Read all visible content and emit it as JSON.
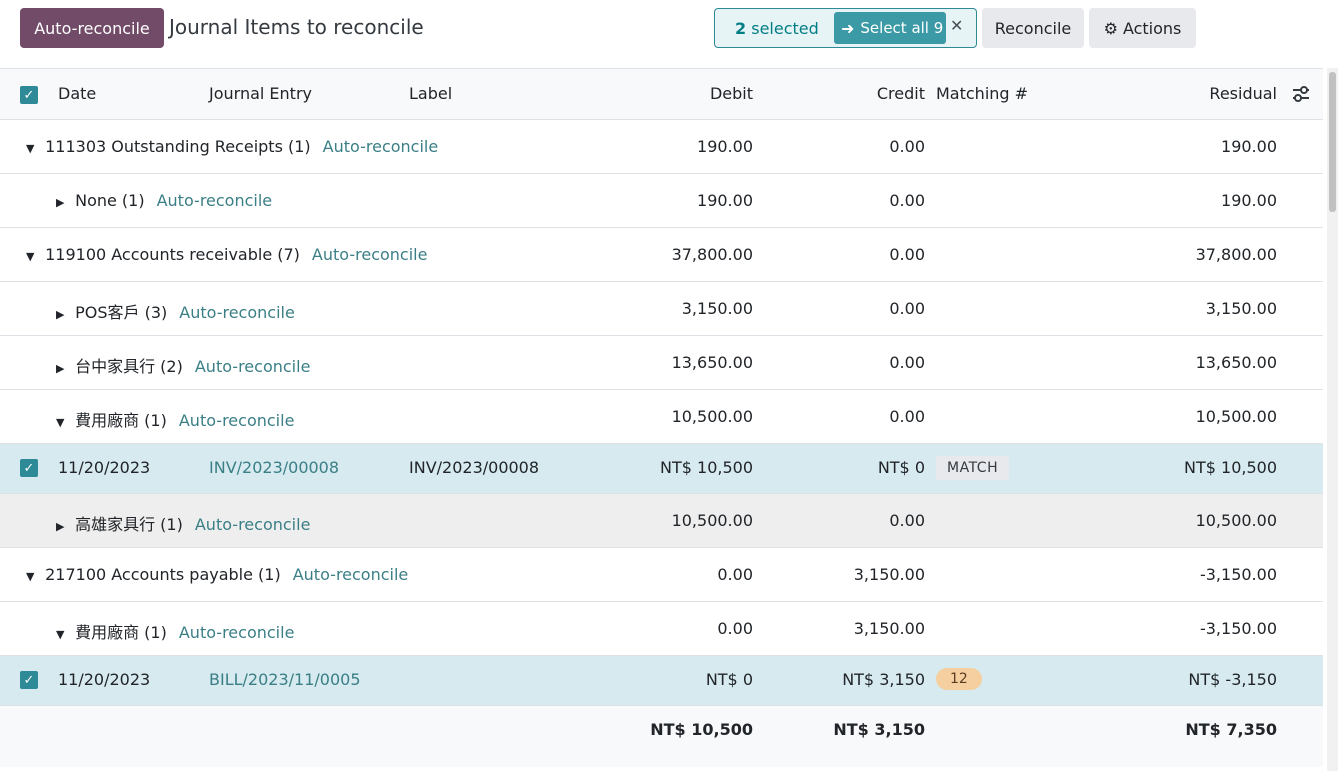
{
  "toolbar": {
    "auto_reconcile_label": "Auto-reconcile",
    "title": "Journal Items to reconcile",
    "selected_count": "2",
    "selected_text": "selected",
    "select_all_label": "Select all 9",
    "reconcile_label": "Reconcile",
    "actions_label": "Actions"
  },
  "columns": {
    "date": "Date",
    "journal_entry": "Journal Entry",
    "label": "Label",
    "debit": "Debit",
    "credit": "Credit",
    "matching": "Matching #",
    "residual": "Residual"
  },
  "rows": [
    {
      "name": "111303 Outstanding Receipts (1)",
      "link": "Auto-reconcile",
      "debit": "190.00",
      "credit": "0.00",
      "residual": "190.00"
    },
    {
      "name": "None (1)",
      "link": "Auto-reconcile",
      "debit": "190.00",
      "credit": "0.00",
      "residual": "190.00"
    },
    {
      "name": "119100 Accounts receivable (7)",
      "link": "Auto-reconcile",
      "debit": "37,800.00",
      "credit": "0.00",
      "residual": "37,800.00"
    },
    {
      "name": "POS客戶 (3)",
      "link": "Auto-reconcile",
      "debit": "3,150.00",
      "credit": "0.00",
      "residual": "3,150.00"
    },
    {
      "name": "台中家具行 (2)",
      "link": "Auto-reconcile",
      "debit": "13,650.00",
      "credit": "0.00",
      "residual": "13,650.00"
    },
    {
      "name": "費用廠商 (1)",
      "link": "Auto-reconcile",
      "debit": "10,500.00",
      "credit": "0.00",
      "residual": "10,500.00"
    },
    {
      "date": "11/20/2023",
      "entry": "INV/2023/00008",
      "label": "INV/2023/00008",
      "debit": "NT$ 10,500",
      "credit": "NT$ 0",
      "matching": "MATCH",
      "residual": "NT$ 10,500"
    },
    {
      "name": "高雄家具行 (1)",
      "link": "Auto-reconcile",
      "debit": "10,500.00",
      "credit": "0.00",
      "residual": "10,500.00"
    },
    {
      "name": "217100 Accounts payable (1)",
      "link": "Auto-reconcile",
      "debit": "0.00",
      "credit": "3,150.00",
      "residual": "-3,150.00"
    },
    {
      "name": "費用廠商 (1)",
      "link": "Auto-reconcile",
      "debit": "0.00",
      "credit": "3,150.00",
      "residual": "-3,150.00"
    },
    {
      "date": "11/20/2023",
      "entry": "BILL/2023/11/0005",
      "label": "",
      "debit": "NT$ 0",
      "credit": "NT$ 3,150",
      "matching": "12",
      "residual": "NT$ -3,150"
    }
  ],
  "totals": {
    "debit": "NT$ 10,500",
    "credit": "NT$ 3,150",
    "residual": "NT$ 7,350"
  },
  "icons": {
    "select_all": "arrow-right-icon",
    "clear": "close-icon",
    "actions": "gear-icon",
    "columns": "sliders-icon",
    "expanded": "caret-down-icon",
    "collapsed": "caret-right-icon"
  },
  "colors": {
    "primary": "#714b67",
    "accent": "#017e84",
    "selected_row": "#d6eaef",
    "match_badge": "#f6cfa0"
  }
}
